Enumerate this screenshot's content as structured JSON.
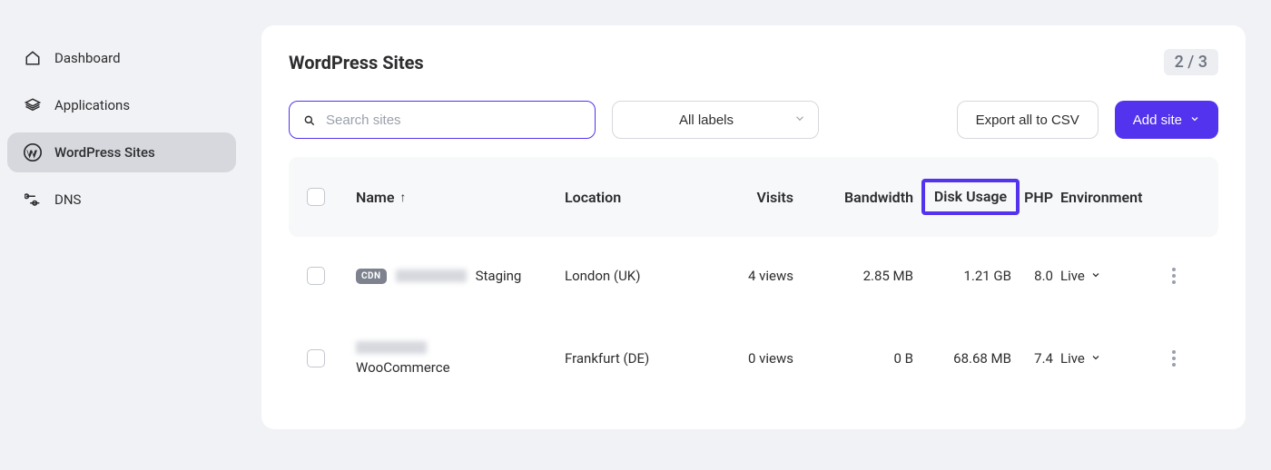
{
  "sidebar": {
    "items": [
      {
        "label": "Dashboard"
      },
      {
        "label": "Applications"
      },
      {
        "label": "WordPress Sites"
      },
      {
        "label": "DNS"
      }
    ]
  },
  "page": {
    "title": "WordPress Sites",
    "counter": "2 / 3"
  },
  "toolbar": {
    "search_placeholder": "Search sites",
    "labels_select": "All labels",
    "export_label": "Export all to CSV",
    "add_label": "Add site"
  },
  "columns": {
    "name": "Name",
    "location": "Location",
    "visits": "Visits",
    "bandwidth": "Bandwidth",
    "disk": "Disk Usage",
    "php": "PHP",
    "environment": "Environment"
  },
  "rows": [
    {
      "cdn": "CDN",
      "name_suffix": "Staging",
      "location": "London (UK)",
      "visits": "4 views",
      "bandwidth": "2.85 MB",
      "disk": "1.21 GB",
      "php": "8.0",
      "env": "Live"
    },
    {
      "cdn": "",
      "name_suffix": "WooCommerce",
      "location": "Frankfurt (DE)",
      "visits": "0 views",
      "bandwidth": "0 B",
      "disk": "68.68 MB",
      "php": "7.4",
      "env": "Live"
    }
  ]
}
